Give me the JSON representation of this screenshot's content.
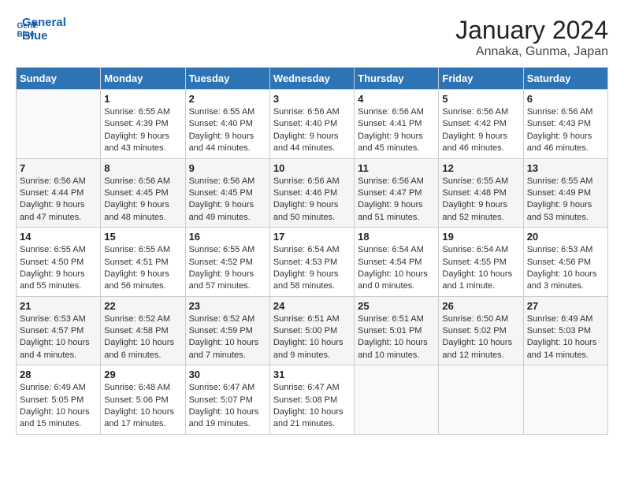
{
  "header": {
    "logo_line1": "General",
    "logo_line2": "Blue",
    "title": "January 2024",
    "subtitle": "Annaka, Gunma, Japan"
  },
  "columns": [
    "Sunday",
    "Monday",
    "Tuesday",
    "Wednesday",
    "Thursday",
    "Friday",
    "Saturday"
  ],
  "weeks": [
    [
      {
        "day": "",
        "info": ""
      },
      {
        "day": "1",
        "info": "Sunrise: 6:55 AM\nSunset: 4:39 PM\nDaylight: 9 hours\nand 43 minutes."
      },
      {
        "day": "2",
        "info": "Sunrise: 6:55 AM\nSunset: 4:40 PM\nDaylight: 9 hours\nand 44 minutes."
      },
      {
        "day": "3",
        "info": "Sunrise: 6:56 AM\nSunset: 4:40 PM\nDaylight: 9 hours\nand 44 minutes."
      },
      {
        "day": "4",
        "info": "Sunrise: 6:56 AM\nSunset: 4:41 PM\nDaylight: 9 hours\nand 45 minutes."
      },
      {
        "day": "5",
        "info": "Sunrise: 6:56 AM\nSunset: 4:42 PM\nDaylight: 9 hours\nand 46 minutes."
      },
      {
        "day": "6",
        "info": "Sunrise: 6:56 AM\nSunset: 4:43 PM\nDaylight: 9 hours\nand 46 minutes."
      }
    ],
    [
      {
        "day": "7",
        "info": "Sunrise: 6:56 AM\nSunset: 4:44 PM\nDaylight: 9 hours\nand 47 minutes."
      },
      {
        "day": "8",
        "info": "Sunrise: 6:56 AM\nSunset: 4:45 PM\nDaylight: 9 hours\nand 48 minutes."
      },
      {
        "day": "9",
        "info": "Sunrise: 6:56 AM\nSunset: 4:45 PM\nDaylight: 9 hours\nand 49 minutes."
      },
      {
        "day": "10",
        "info": "Sunrise: 6:56 AM\nSunset: 4:46 PM\nDaylight: 9 hours\nand 50 minutes."
      },
      {
        "day": "11",
        "info": "Sunrise: 6:56 AM\nSunset: 4:47 PM\nDaylight: 9 hours\nand 51 minutes."
      },
      {
        "day": "12",
        "info": "Sunrise: 6:55 AM\nSunset: 4:48 PM\nDaylight: 9 hours\nand 52 minutes."
      },
      {
        "day": "13",
        "info": "Sunrise: 6:55 AM\nSunset: 4:49 PM\nDaylight: 9 hours\nand 53 minutes."
      }
    ],
    [
      {
        "day": "14",
        "info": "Sunrise: 6:55 AM\nSunset: 4:50 PM\nDaylight: 9 hours\nand 55 minutes."
      },
      {
        "day": "15",
        "info": "Sunrise: 6:55 AM\nSunset: 4:51 PM\nDaylight: 9 hours\nand 56 minutes."
      },
      {
        "day": "16",
        "info": "Sunrise: 6:55 AM\nSunset: 4:52 PM\nDaylight: 9 hours\nand 57 minutes."
      },
      {
        "day": "17",
        "info": "Sunrise: 6:54 AM\nSunset: 4:53 PM\nDaylight: 9 hours\nand 58 minutes."
      },
      {
        "day": "18",
        "info": "Sunrise: 6:54 AM\nSunset: 4:54 PM\nDaylight: 10 hours\nand 0 minutes."
      },
      {
        "day": "19",
        "info": "Sunrise: 6:54 AM\nSunset: 4:55 PM\nDaylight: 10 hours\nand 1 minute."
      },
      {
        "day": "20",
        "info": "Sunrise: 6:53 AM\nSunset: 4:56 PM\nDaylight: 10 hours\nand 3 minutes."
      }
    ],
    [
      {
        "day": "21",
        "info": "Sunrise: 6:53 AM\nSunset: 4:57 PM\nDaylight: 10 hours\nand 4 minutes."
      },
      {
        "day": "22",
        "info": "Sunrise: 6:52 AM\nSunset: 4:58 PM\nDaylight: 10 hours\nand 6 minutes."
      },
      {
        "day": "23",
        "info": "Sunrise: 6:52 AM\nSunset: 4:59 PM\nDaylight: 10 hours\nand 7 minutes."
      },
      {
        "day": "24",
        "info": "Sunrise: 6:51 AM\nSunset: 5:00 PM\nDaylight: 10 hours\nand 9 minutes."
      },
      {
        "day": "25",
        "info": "Sunrise: 6:51 AM\nSunset: 5:01 PM\nDaylight: 10 hours\nand 10 minutes."
      },
      {
        "day": "26",
        "info": "Sunrise: 6:50 AM\nSunset: 5:02 PM\nDaylight: 10 hours\nand 12 minutes."
      },
      {
        "day": "27",
        "info": "Sunrise: 6:49 AM\nSunset: 5:03 PM\nDaylight: 10 hours\nand 14 minutes."
      }
    ],
    [
      {
        "day": "28",
        "info": "Sunrise: 6:49 AM\nSunset: 5:05 PM\nDaylight: 10 hours\nand 15 minutes."
      },
      {
        "day": "29",
        "info": "Sunrise: 6:48 AM\nSunset: 5:06 PM\nDaylight: 10 hours\nand 17 minutes."
      },
      {
        "day": "30",
        "info": "Sunrise: 6:47 AM\nSunset: 5:07 PM\nDaylight: 10 hours\nand 19 minutes."
      },
      {
        "day": "31",
        "info": "Sunrise: 6:47 AM\nSunset: 5:08 PM\nDaylight: 10 hours\nand 21 minutes."
      },
      {
        "day": "",
        "info": ""
      },
      {
        "day": "",
        "info": ""
      },
      {
        "day": "",
        "info": ""
      }
    ]
  ]
}
